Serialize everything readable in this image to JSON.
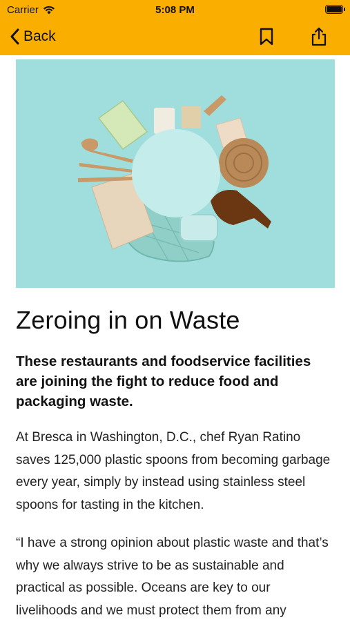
{
  "status_bar": {
    "carrier": "Carrier",
    "time": "5:08 PM"
  },
  "nav": {
    "back_label": "Back",
    "icons": [
      "bookmark-icon",
      "share-icon"
    ]
  },
  "colors": {
    "accent": "#F9AE00",
    "hero_background": "#9fdedd"
  },
  "article": {
    "title": "Zeroing in on Waste",
    "subtitle": "These restaurants and foodservice facilities are joining the fight to reduce food and packaging waste.",
    "paragraphs": [
      "At Bresca in Washington, D.C., chef Ryan Ratino saves 125,000 plastic spoons from becoming garbage every year, simply by instead using stainless steel spoons for tasting in the kitchen.",
      "“I have a strong opinion about plastic waste and that’s why we always strive to be as sustainable and practical as possible. Oceans are key to our livelihoods and we must protect them from any"
    ]
  }
}
